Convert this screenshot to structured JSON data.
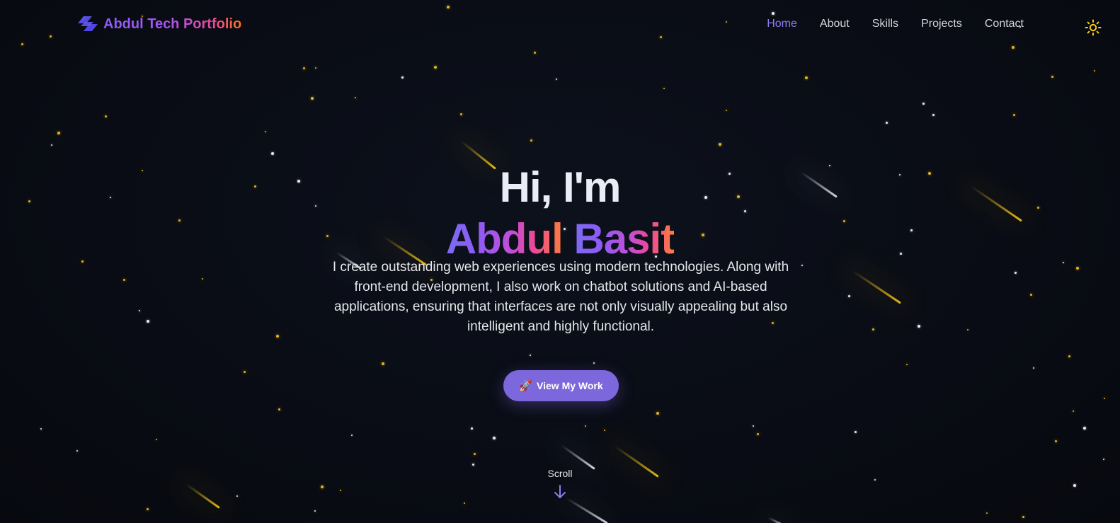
{
  "brand": {
    "name": "Abdul Tech Portfolio"
  },
  "nav": {
    "links": [
      {
        "label": "Home",
        "active": true
      },
      {
        "label": "About",
        "active": false
      },
      {
        "label": "Skills",
        "active": false
      },
      {
        "label": "Projects",
        "active": false
      },
      {
        "label": "Contact",
        "active": false
      }
    ],
    "theme_toggle_icon": "sun-icon"
  },
  "hero": {
    "greeting": "Hi, I'm",
    "name_first": "Abdul",
    "name_last": "Basit",
    "description": "I create outstanding web experiences using modern technologies. Along with front-end development, I also work on chatbot solutions and AI-based applications, ensuring that interfaces are not only visually appealing but also intelligent and highly functional.",
    "cta_label": "View My Work",
    "cta_icon": "rocket-icon"
  },
  "scroll": {
    "label": "Scroll",
    "icon": "arrow-down-icon"
  },
  "colors": {
    "background": "#0a0d16",
    "accent": "#7c68dc",
    "nav_active": "#8b7cf0",
    "star_yellow": "#e6b422",
    "star_white": "#e9ecf5"
  }
}
